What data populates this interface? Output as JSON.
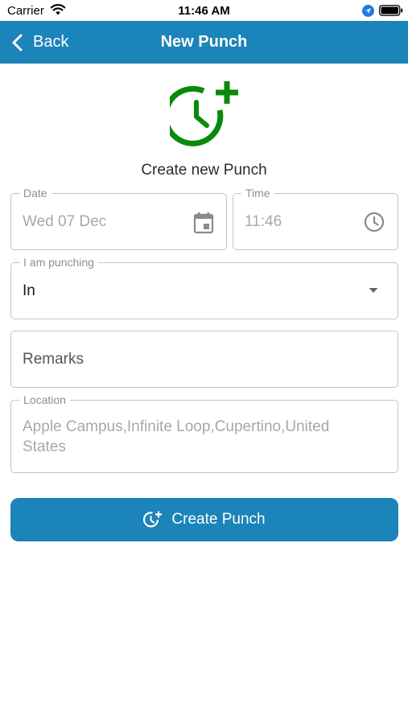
{
  "status_bar": {
    "carrier": "Carrier",
    "time": "11:46 AM",
    "icons": [
      "wifi-icon",
      "location-arrow-icon",
      "battery-icon"
    ]
  },
  "nav": {
    "back_label": "Back",
    "title": "New Punch",
    "background_color": "#1b84b8"
  },
  "hero": {
    "icon": "clock-plus-icon",
    "icon_color": "#0a8a0a",
    "title": "Create new Punch"
  },
  "form": {
    "date": {
      "label": "Date",
      "value": "Wed 07 Dec",
      "icon": "calendar-icon"
    },
    "time": {
      "label": "Time",
      "value": "11:46",
      "icon": "clock-icon"
    },
    "punching": {
      "label": "I am punching",
      "value": "In",
      "icon": "dropdown-arrow-icon"
    },
    "remarks": {
      "placeholder": "Remarks"
    },
    "location": {
      "label": "Location",
      "value": "Apple Campus,Infinite Loop,Cupertino,United States"
    }
  },
  "submit": {
    "label": "Create Punch",
    "icon": "clock-plus-icon",
    "background_color": "#1b84b8"
  }
}
